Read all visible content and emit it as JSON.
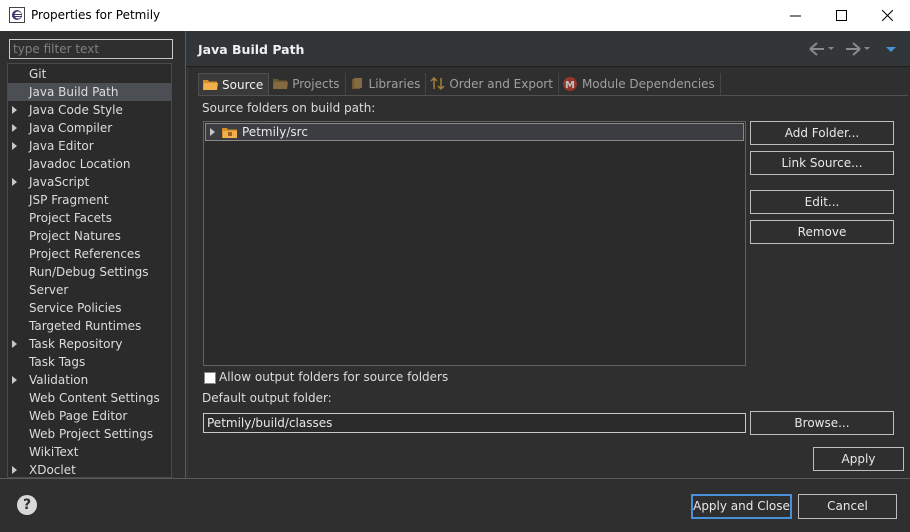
{
  "window": {
    "title": "Properties for Petmily"
  },
  "filter": {
    "placeholder": "type filter text"
  },
  "tree": {
    "items": [
      {
        "label": "Git",
        "expandable": false
      },
      {
        "label": "Java Build Path",
        "expandable": false,
        "selected": true
      },
      {
        "label": "Java Code Style",
        "expandable": true
      },
      {
        "label": "Java Compiler",
        "expandable": true
      },
      {
        "label": "Java Editor",
        "expandable": true
      },
      {
        "label": "Javadoc Location",
        "expandable": false
      },
      {
        "label": "JavaScript",
        "expandable": true
      },
      {
        "label": "JSP Fragment",
        "expandable": false
      },
      {
        "label": "Project Facets",
        "expandable": false
      },
      {
        "label": "Project Natures",
        "expandable": false
      },
      {
        "label": "Project References",
        "expandable": false
      },
      {
        "label": "Run/Debug Settings",
        "expandable": false
      },
      {
        "label": "Server",
        "expandable": false
      },
      {
        "label": "Service Policies",
        "expandable": false
      },
      {
        "label": "Targeted Runtimes",
        "expandable": false
      },
      {
        "label": "Task Repository",
        "expandable": true
      },
      {
        "label": "Task Tags",
        "expandable": false
      },
      {
        "label": "Validation",
        "expandable": true
      },
      {
        "label": "Web Content Settings",
        "expandable": false
      },
      {
        "label": "Web Page Editor",
        "expandable": false
      },
      {
        "label": "Web Project Settings",
        "expandable": false
      },
      {
        "label": "WikiText",
        "expandable": false
      },
      {
        "label": "XDoclet",
        "expandable": true
      }
    ]
  },
  "page": {
    "title": "Java Build Path"
  },
  "tabs": [
    {
      "label": "Source",
      "icon": "source-folder-icon",
      "active": true
    },
    {
      "label": "Projects",
      "icon": "projects-icon",
      "active": false
    },
    {
      "label": "Libraries",
      "icon": "libraries-icon",
      "active": false
    },
    {
      "label": "Order and Export",
      "icon": "order-icon",
      "active": false
    },
    {
      "label": "Module Dependencies",
      "icon": "module-icon",
      "active": false
    }
  ],
  "source": {
    "list_label": "Source folders on build path:",
    "folders": [
      "Petmily/src"
    ],
    "allow_output_label": "Allow output folders for source folders",
    "default_output_label": "Default output folder:",
    "default_output_value": "Petmily/build/classes"
  },
  "buttons": {
    "add_folder": "Add Folder...",
    "link_source": "Link Source...",
    "edit": "Edit...",
    "remove": "Remove",
    "browse": "Browse...",
    "apply": "Apply",
    "apply_and_close": "Apply and Close",
    "cancel": "Cancel"
  },
  "colors": {
    "background": "#2f2f2f",
    "accent": "#4a90d9",
    "folder": "#e8a33c"
  }
}
